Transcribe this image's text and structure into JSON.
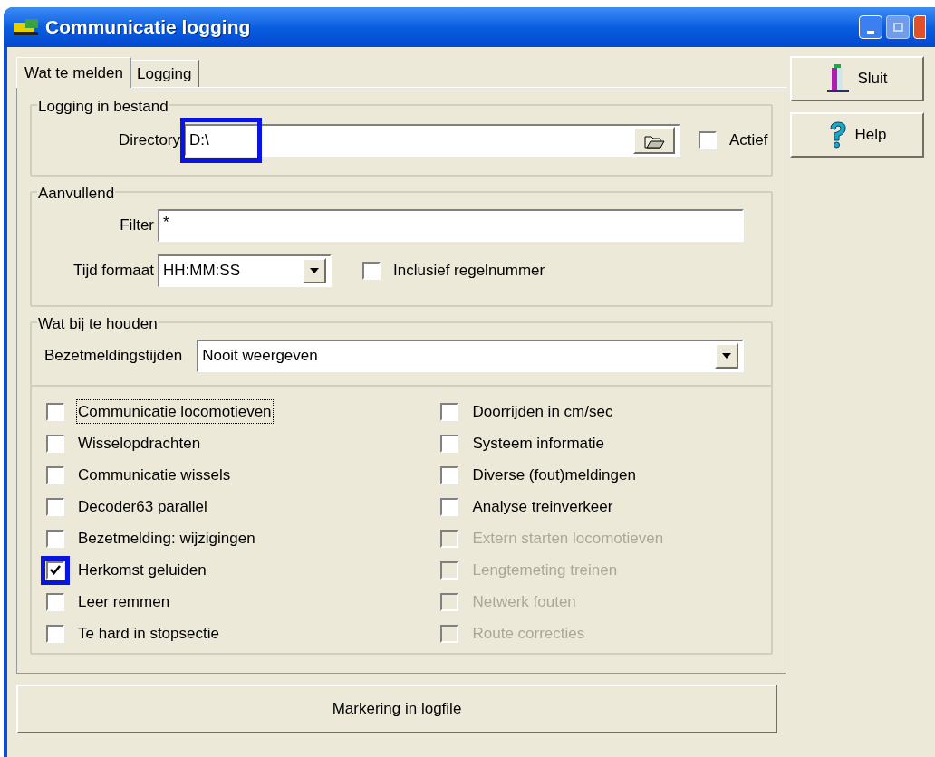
{
  "window": {
    "title": "Communicatie logging"
  },
  "tabs": [
    {
      "label": "Wat te melden",
      "selected": true
    },
    {
      "label": "Logging",
      "selected": false
    }
  ],
  "side_buttons": [
    {
      "kind": "close",
      "label": "Sluit"
    },
    {
      "kind": "help",
      "label": "Help"
    }
  ],
  "logging_group": {
    "title": "Logging in bestand",
    "directory_label": "Directory",
    "directory_value": "D:\\",
    "highlighted": true,
    "active": {
      "label": "Actief",
      "checked": false
    }
  },
  "extra_group": {
    "title": "Aanvullend",
    "filter_label": "Filter",
    "filter_value": "*",
    "time_label": "Tijd formaat",
    "time_value": "HH:MM:SS",
    "line_numbers": {
      "label": "Inclusief regelnummer",
      "checked": false
    }
  },
  "keep_group": {
    "title": "Wat bij te houden",
    "occupancy_label": "Bezetmeldingstijden",
    "occupancy_value": "Nooit weergeven",
    "left_options": [
      {
        "label": "Communicatie locomotieven",
        "checked": false,
        "disabled": false,
        "focused": true,
        "highlighted": false
      },
      {
        "label": "Wisselopdrachten",
        "checked": false,
        "disabled": false,
        "focused": false,
        "highlighted": false
      },
      {
        "label": "Communicatie wissels",
        "checked": false,
        "disabled": false,
        "focused": false,
        "highlighted": false
      },
      {
        "label": "Decoder63 parallel",
        "checked": false,
        "disabled": false,
        "focused": false,
        "highlighted": false
      },
      {
        "label": "Bezetmelding: wijzigingen",
        "checked": false,
        "disabled": false,
        "focused": false,
        "highlighted": false
      },
      {
        "label": "Herkomst geluiden",
        "checked": true,
        "disabled": false,
        "focused": false,
        "highlighted": true
      },
      {
        "label": "Leer remmen",
        "checked": false,
        "disabled": false,
        "focused": false,
        "highlighted": false
      },
      {
        "label": "Te hard in stopsectie",
        "checked": false,
        "disabled": false,
        "focused": false,
        "highlighted": false
      }
    ],
    "right_options": [
      {
        "label": "Doorrijden in cm/sec",
        "checked": false,
        "disabled": false,
        "focused": false,
        "highlighted": false
      },
      {
        "label": "Systeem informatie",
        "checked": false,
        "disabled": false,
        "focused": false,
        "highlighted": false
      },
      {
        "label": "Diverse (fout)meldingen",
        "checked": false,
        "disabled": false,
        "focused": false,
        "highlighted": false
      },
      {
        "label": "Analyse treinverkeer",
        "checked": false,
        "disabled": false,
        "focused": false,
        "highlighted": false
      },
      {
        "label": "Extern starten locomotieven",
        "checked": false,
        "disabled": true,
        "focused": false,
        "highlighted": false
      },
      {
        "label": "Lengtemeting treinen",
        "checked": false,
        "disabled": true,
        "focused": false,
        "highlighted": false
      },
      {
        "label": "Netwerk fouten",
        "checked": false,
        "disabled": true,
        "focused": false,
        "highlighted": false
      },
      {
        "label": "Route correcties",
        "checked": false,
        "disabled": true,
        "focused": false,
        "highlighted": false
      }
    ]
  },
  "marker_button": "Markering in logfile"
}
